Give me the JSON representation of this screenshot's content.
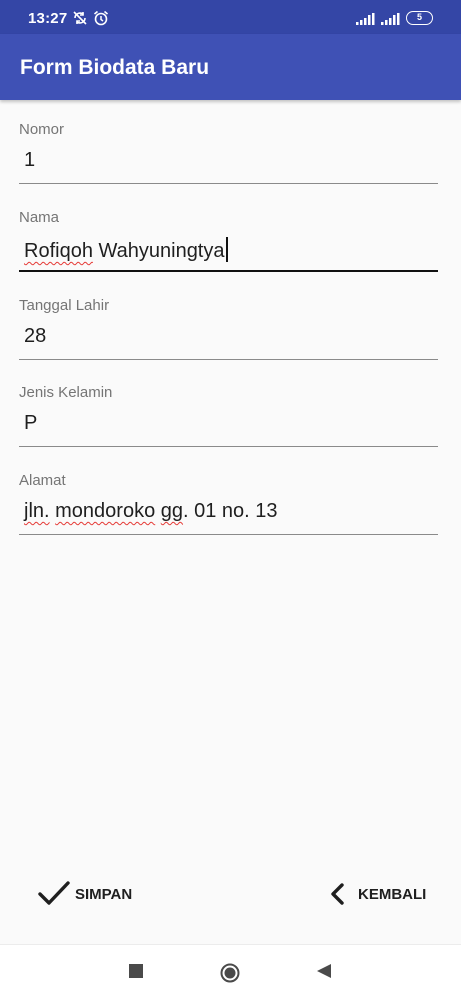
{
  "status_bar": {
    "time": "13:27",
    "battery": "5",
    "icons": [
      "sync-disabled-icon",
      "alarm-icon",
      "signal-icon",
      "signal-icon",
      "battery-icon"
    ]
  },
  "app_bar": {
    "title": "Form Biodata Baru",
    "color": "#3f51b5"
  },
  "form": {
    "nomor": {
      "label": "Nomor",
      "value": "1"
    },
    "nama": {
      "label": "Nama",
      "value_part1": "Rofiqoh",
      "value_part2": " Wahyuningtya"
    },
    "tanggal_lahir": {
      "label": "Tanggal Lahir",
      "value": "28"
    },
    "jenis_kelamin": {
      "label": "Jenis Kelamin",
      "value": "P"
    },
    "alamat": {
      "label": "Alamat",
      "value_parts": [
        "jln.",
        " ",
        "mondoroko",
        " ",
        "gg",
        ". 01 no. 13"
      ]
    }
  },
  "actions": {
    "save_label": "SIMPAN",
    "save_icon": "check-icon",
    "back_label": "KEMBALI",
    "back_icon": "chevron-left-icon"
  },
  "nav_bar": {
    "buttons": [
      "recent-apps-icon",
      "home-icon",
      "back-icon"
    ]
  }
}
